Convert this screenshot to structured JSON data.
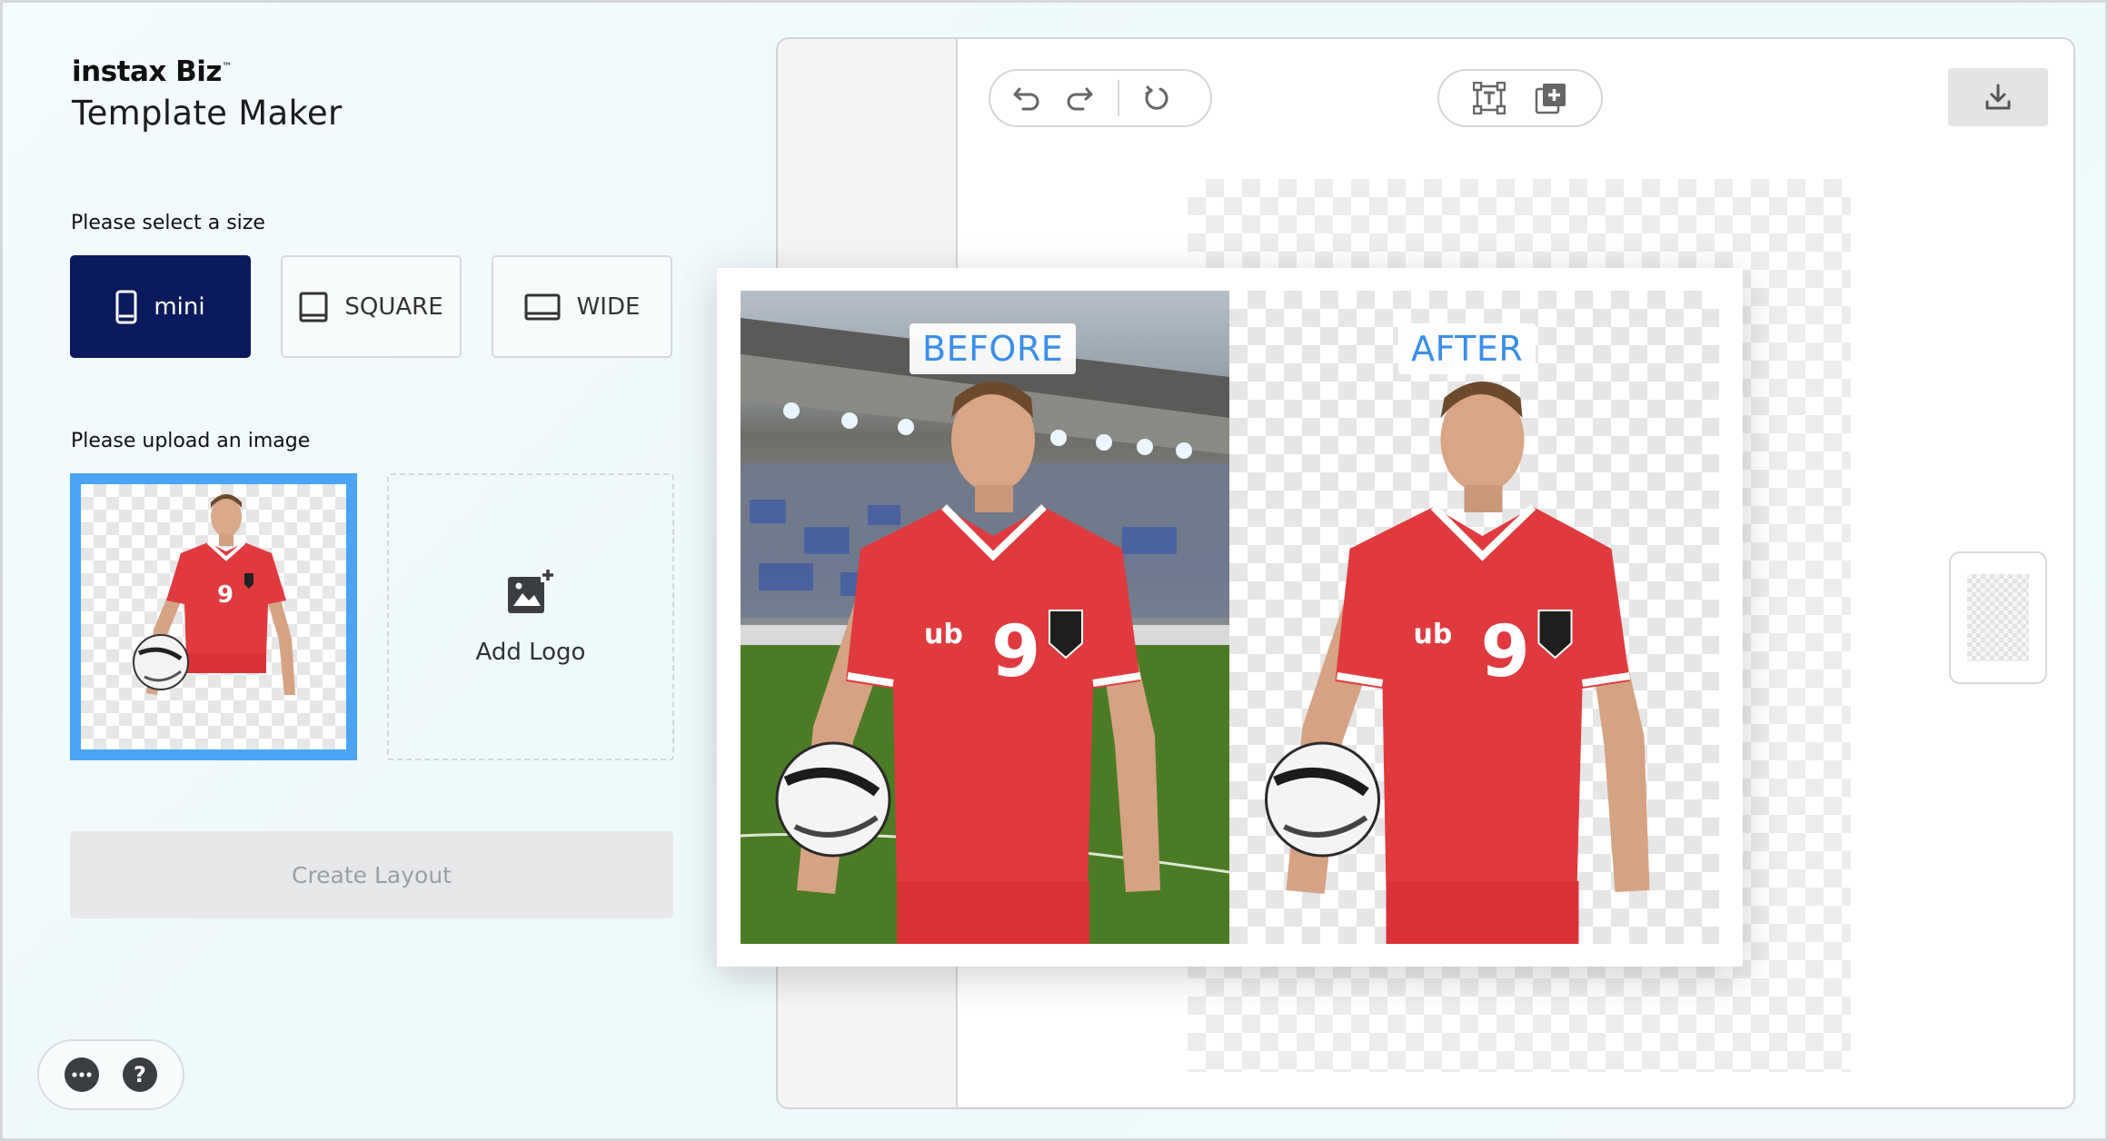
{
  "brand": {
    "name": "instax Biz",
    "trademark": "™",
    "product": "Template Maker"
  },
  "size_section": {
    "label": "Please select a size",
    "options": [
      {
        "label": "mini",
        "icon": "portrait-frame-icon",
        "selected": true
      },
      {
        "label": "SQUARE",
        "icon": "square-frame-icon",
        "selected": false
      },
      {
        "label": "WIDE",
        "icon": "landscape-frame-icon",
        "selected": false
      }
    ]
  },
  "upload_section": {
    "label": "Please upload an image",
    "add_logo_label": "Add Logo"
  },
  "create_button": {
    "label": "Create Layout",
    "enabled": false
  },
  "help": {
    "more_icon": "more-icon",
    "help_icon": "help-icon",
    "help_glyph": "?"
  },
  "toolbar": {
    "history": [
      "undo-icon",
      "redo-icon",
      "reset-icon"
    ],
    "insert": [
      "add-text-icon",
      "add-image-icon"
    ],
    "download": "download-icon"
  },
  "compare": {
    "before_label": "BEFORE",
    "after_label": "AFTER",
    "jersey_number": "9"
  },
  "colors": {
    "accent_dark": "#0a1a5c",
    "accent_blue": "#4ba3f3",
    "label_blue": "#3a8ee8",
    "jersey_red": "#e03a3e"
  }
}
